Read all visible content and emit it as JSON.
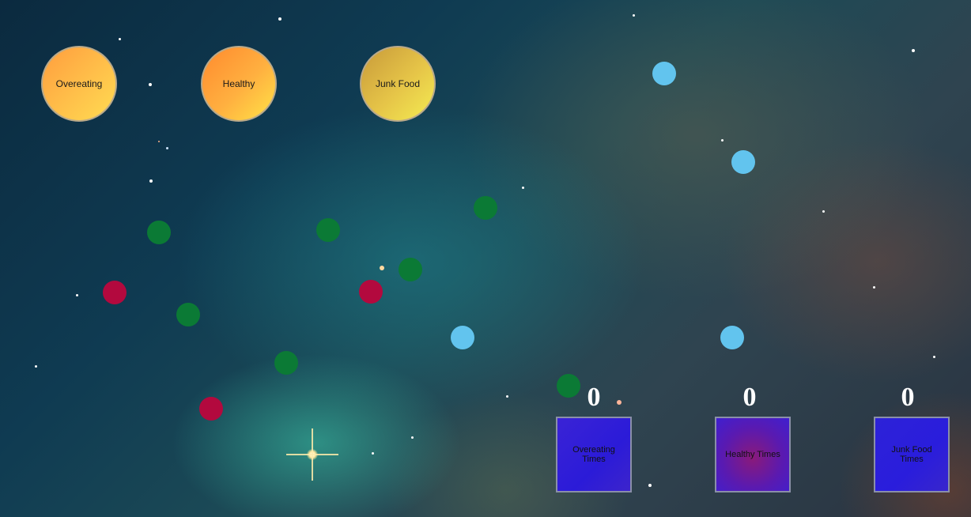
{
  "buckets": {
    "overeating": "Overeating",
    "healthy": "Healthy",
    "junk_food": "Junk Food"
  },
  "scoreboard": {
    "overeating": {
      "count": "0",
      "label": "Overeating Times"
    },
    "healthy": {
      "count": "0",
      "label": "Healthy Times"
    },
    "junk_food": {
      "count": "0",
      "label": "Junk Food Times"
    }
  },
  "colors": {
    "food_green": "#0b7a35",
    "food_red": "#b3093e",
    "food_blue": "#62c4ee",
    "bucket_gold": "#ffc04a",
    "box_blue": "#2b1bd8",
    "box_purple": "#8a1a7a"
  }
}
